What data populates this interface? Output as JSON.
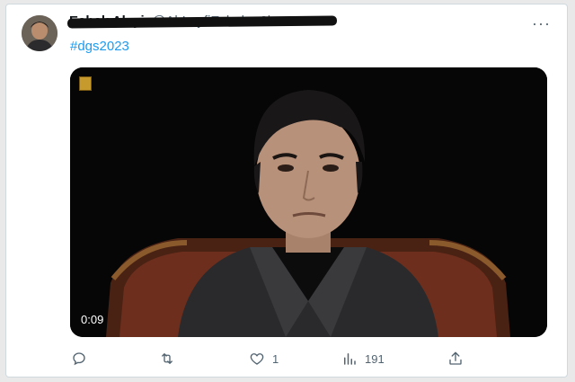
{
  "tweet": {
    "display_name": "Eshak Alayi",
    "handle": "@AhLeyfiEshak · 2h",
    "hashtag": "#dgs2023",
    "more_label": "···"
  },
  "media": {
    "duration": "0:09",
    "channel_logo": "channel-logo"
  },
  "actions": {
    "reply": {
      "icon": "reply-icon",
      "count": ""
    },
    "retweet": {
      "icon": "retweet-icon",
      "count": ""
    },
    "like": {
      "icon": "heart-icon",
      "count": "1"
    },
    "views": {
      "icon": "views-icon",
      "count": "191"
    },
    "share": {
      "icon": "share-icon",
      "count": ""
    }
  },
  "colors": {
    "hashtag": "#1d9bf0",
    "icon_gray": "#536471"
  }
}
